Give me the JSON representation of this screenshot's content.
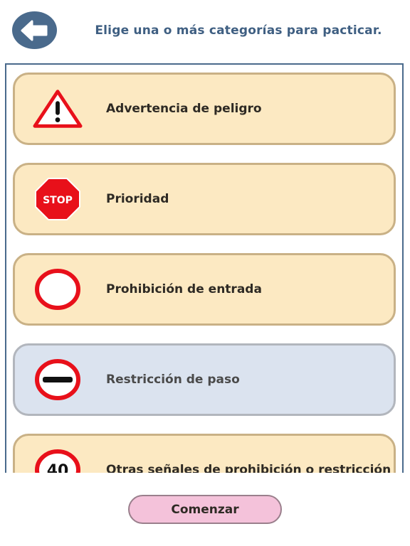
{
  "header": {
    "title": "Elige una o más categorías para pacticar.",
    "back_icon": "arrow-left-icon"
  },
  "categories": [
    {
      "label": "Advertencia de peligro",
      "icon": "warning-triangle-icon",
      "selected": false
    },
    {
      "label": "Prioridad",
      "icon": "stop-sign-icon",
      "icon_text": "STOP",
      "selected": false
    },
    {
      "label": "Prohibición de entrada",
      "icon": "no-entry-circle-icon",
      "selected": false
    },
    {
      "label": "Restricción de paso",
      "icon": "no-entry-bar-icon",
      "selected": true
    },
    {
      "label": "Otras señales de prohibición o restricción",
      "icon": "speed-limit-icon",
      "icon_text": "40",
      "selected": false
    }
  ],
  "footer": {
    "start_label": "Comenzar"
  },
  "colors": {
    "card_background": "#fce9c2",
    "card_border": "#c9b186",
    "selected_background": "#dbe3ef",
    "header_blue": "#4a6a8c",
    "sign_red": "#e8101a",
    "start_button": "#f4c2da"
  }
}
